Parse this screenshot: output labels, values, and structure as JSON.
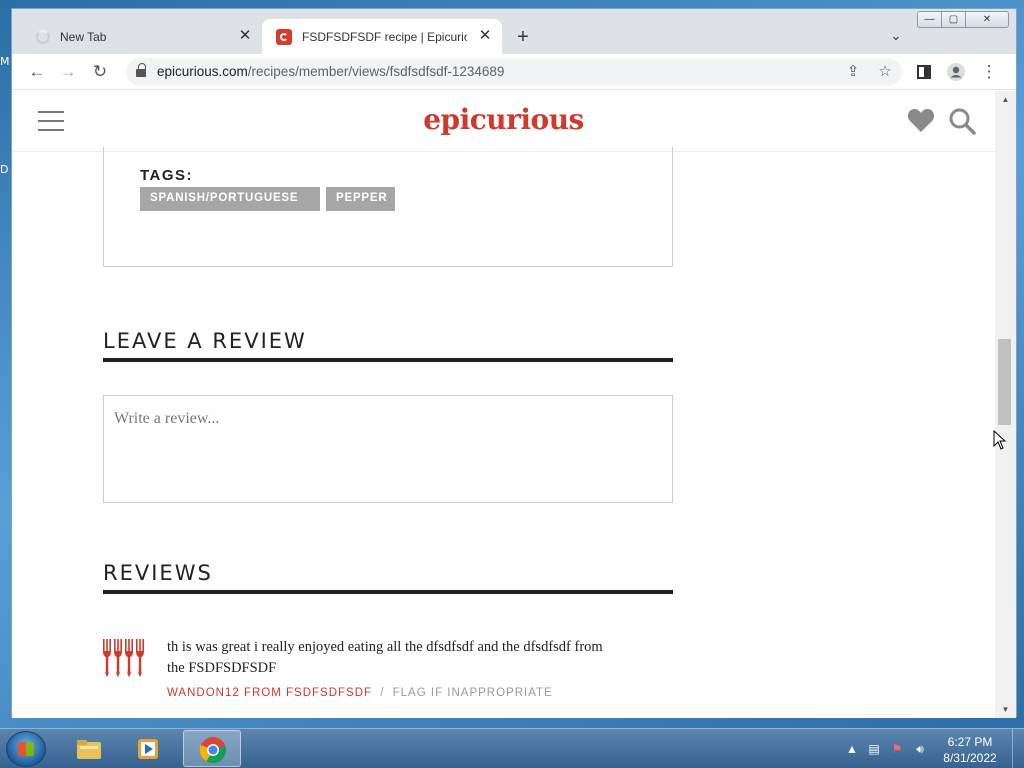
{
  "desktop": {
    "left_edge_letters": [
      "M",
      "D"
    ]
  },
  "browser": {
    "tabs": [
      {
        "title": "New Tab",
        "close": "✕"
      },
      {
        "title": "FSDFSDFSDF recipe | Epicurious.c",
        "close": "✕"
      }
    ],
    "new_tab": "+",
    "window_controls": {
      "minimize": "—",
      "maximize": "▢",
      "close": "✕"
    },
    "url_host": "epicurious.com",
    "url_path": "/recipes/member/views/fsdfsdfsdf-1234689"
  },
  "site": {
    "logo": "epicurious",
    "accent_color": "#d0392b"
  },
  "tags": {
    "label": "TAGS:",
    "items": [
      "SPANISH/PORTUGUESE",
      "PEPPER"
    ]
  },
  "leave_review": {
    "title": "LEAVE A REVIEW",
    "placeholder": "Write a review..."
  },
  "reviews": {
    "title": "REVIEWS",
    "items": [
      {
        "text": "th is was great i really enjoyed eating all the dfsdfsdf and the dfsdfsdf from the FSDFSDFSDF",
        "author": "WANDON12 FROM FSDFSDFSDF",
        "separator": "/",
        "flag": "FLAG IF INAPPROPRIATE",
        "rating_forks": 4
      }
    ]
  },
  "taskbar": {
    "clock_time": "6:27 PM",
    "clock_date": "8/31/2022"
  }
}
